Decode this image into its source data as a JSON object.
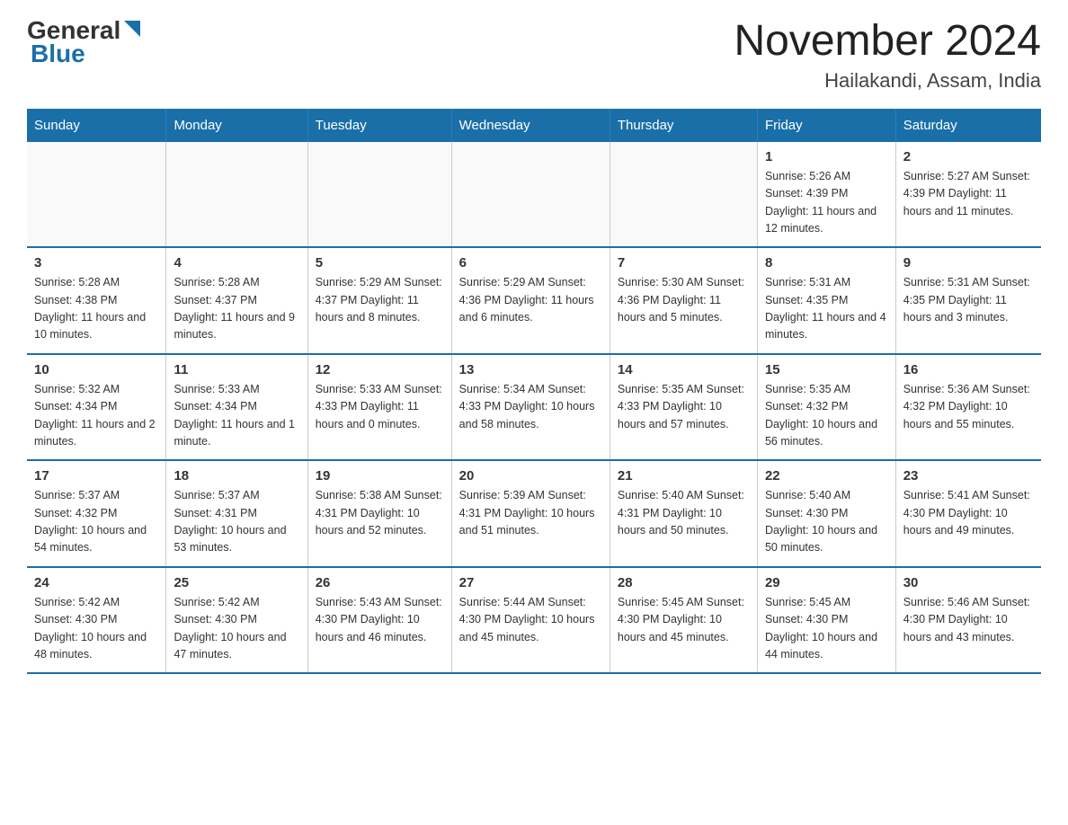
{
  "header": {
    "logo_general": "General",
    "logo_blue": "Blue",
    "title": "November 2024",
    "subtitle": "Hailakandi, Assam, India"
  },
  "days_of_week": [
    "Sunday",
    "Monday",
    "Tuesday",
    "Wednesday",
    "Thursday",
    "Friday",
    "Saturday"
  ],
  "weeks": [
    [
      {
        "day": "",
        "info": ""
      },
      {
        "day": "",
        "info": ""
      },
      {
        "day": "",
        "info": ""
      },
      {
        "day": "",
        "info": ""
      },
      {
        "day": "",
        "info": ""
      },
      {
        "day": "1",
        "info": "Sunrise: 5:26 AM\nSunset: 4:39 PM\nDaylight: 11 hours\nand 12 minutes."
      },
      {
        "day": "2",
        "info": "Sunrise: 5:27 AM\nSunset: 4:39 PM\nDaylight: 11 hours\nand 11 minutes."
      }
    ],
    [
      {
        "day": "3",
        "info": "Sunrise: 5:28 AM\nSunset: 4:38 PM\nDaylight: 11 hours\nand 10 minutes."
      },
      {
        "day": "4",
        "info": "Sunrise: 5:28 AM\nSunset: 4:37 PM\nDaylight: 11 hours\nand 9 minutes."
      },
      {
        "day": "5",
        "info": "Sunrise: 5:29 AM\nSunset: 4:37 PM\nDaylight: 11 hours\nand 8 minutes."
      },
      {
        "day": "6",
        "info": "Sunrise: 5:29 AM\nSunset: 4:36 PM\nDaylight: 11 hours\nand 6 minutes."
      },
      {
        "day": "7",
        "info": "Sunrise: 5:30 AM\nSunset: 4:36 PM\nDaylight: 11 hours\nand 5 minutes."
      },
      {
        "day": "8",
        "info": "Sunrise: 5:31 AM\nSunset: 4:35 PM\nDaylight: 11 hours\nand 4 minutes."
      },
      {
        "day": "9",
        "info": "Sunrise: 5:31 AM\nSunset: 4:35 PM\nDaylight: 11 hours\nand 3 minutes."
      }
    ],
    [
      {
        "day": "10",
        "info": "Sunrise: 5:32 AM\nSunset: 4:34 PM\nDaylight: 11 hours\nand 2 minutes."
      },
      {
        "day": "11",
        "info": "Sunrise: 5:33 AM\nSunset: 4:34 PM\nDaylight: 11 hours\nand 1 minute."
      },
      {
        "day": "12",
        "info": "Sunrise: 5:33 AM\nSunset: 4:33 PM\nDaylight: 11 hours\nand 0 minutes."
      },
      {
        "day": "13",
        "info": "Sunrise: 5:34 AM\nSunset: 4:33 PM\nDaylight: 10 hours\nand 58 minutes."
      },
      {
        "day": "14",
        "info": "Sunrise: 5:35 AM\nSunset: 4:33 PM\nDaylight: 10 hours\nand 57 minutes."
      },
      {
        "day": "15",
        "info": "Sunrise: 5:35 AM\nSunset: 4:32 PM\nDaylight: 10 hours\nand 56 minutes."
      },
      {
        "day": "16",
        "info": "Sunrise: 5:36 AM\nSunset: 4:32 PM\nDaylight: 10 hours\nand 55 minutes."
      }
    ],
    [
      {
        "day": "17",
        "info": "Sunrise: 5:37 AM\nSunset: 4:32 PM\nDaylight: 10 hours\nand 54 minutes."
      },
      {
        "day": "18",
        "info": "Sunrise: 5:37 AM\nSunset: 4:31 PM\nDaylight: 10 hours\nand 53 minutes."
      },
      {
        "day": "19",
        "info": "Sunrise: 5:38 AM\nSunset: 4:31 PM\nDaylight: 10 hours\nand 52 minutes."
      },
      {
        "day": "20",
        "info": "Sunrise: 5:39 AM\nSunset: 4:31 PM\nDaylight: 10 hours\nand 51 minutes."
      },
      {
        "day": "21",
        "info": "Sunrise: 5:40 AM\nSunset: 4:31 PM\nDaylight: 10 hours\nand 50 minutes."
      },
      {
        "day": "22",
        "info": "Sunrise: 5:40 AM\nSunset: 4:30 PM\nDaylight: 10 hours\nand 50 minutes."
      },
      {
        "day": "23",
        "info": "Sunrise: 5:41 AM\nSunset: 4:30 PM\nDaylight: 10 hours\nand 49 minutes."
      }
    ],
    [
      {
        "day": "24",
        "info": "Sunrise: 5:42 AM\nSunset: 4:30 PM\nDaylight: 10 hours\nand 48 minutes."
      },
      {
        "day": "25",
        "info": "Sunrise: 5:42 AM\nSunset: 4:30 PM\nDaylight: 10 hours\nand 47 minutes."
      },
      {
        "day": "26",
        "info": "Sunrise: 5:43 AM\nSunset: 4:30 PM\nDaylight: 10 hours\nand 46 minutes."
      },
      {
        "day": "27",
        "info": "Sunrise: 5:44 AM\nSunset: 4:30 PM\nDaylight: 10 hours\nand 45 minutes."
      },
      {
        "day": "28",
        "info": "Sunrise: 5:45 AM\nSunset: 4:30 PM\nDaylight: 10 hours\nand 45 minutes."
      },
      {
        "day": "29",
        "info": "Sunrise: 5:45 AM\nSunset: 4:30 PM\nDaylight: 10 hours\nand 44 minutes."
      },
      {
        "day": "30",
        "info": "Sunrise: 5:46 AM\nSunset: 4:30 PM\nDaylight: 10 hours\nand 43 minutes."
      }
    ]
  ]
}
